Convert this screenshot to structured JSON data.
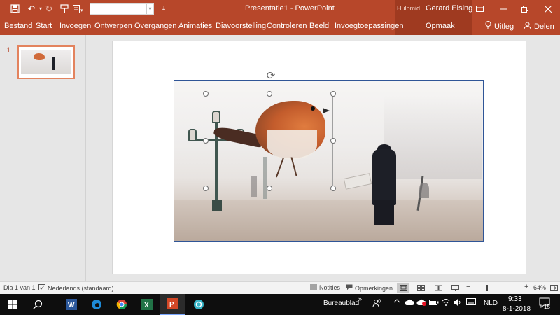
{
  "window": {
    "title": "Presentatie1  -  PowerPoint",
    "contextual_group": "Hulpmid...",
    "user": "Gerard Elsing",
    "controls": [
      "minimize",
      "maximize",
      "close"
    ]
  },
  "quick_access": {
    "icons": [
      "save-icon",
      "undo-icon",
      "redo-icon",
      "format-painter-icon",
      "customize-icon"
    ],
    "combo_value": ""
  },
  "ribbon": {
    "tabs": [
      "Bestand",
      "Start",
      "Invoegen",
      "Ontwerpen",
      "Overgangen",
      "Animaties",
      "Diavoorstelling",
      "Controleren",
      "Beeld",
      "Invoegtoepassingen"
    ],
    "contextual_tab": "Opmaak",
    "tell_me": "Uitleg",
    "share": "Delen"
  },
  "thumbnails": {
    "slides": [
      {
        "number": "1"
      }
    ]
  },
  "status": {
    "slide_info": "Dia 1 van 1",
    "language": "Nederlands (standaard)",
    "notes": "Notities",
    "comments": "Opmerkingen",
    "zoom": "64%"
  },
  "taskbar": {
    "apps": [
      "word-icon",
      "edge-icon",
      "chrome-icon",
      "excel-icon",
      "powerpoint-icon",
      "browser-icon"
    ],
    "active_app": "powerpoint-icon",
    "desktop_label": "Bureaublad",
    "language": "NLD",
    "time": "9:33",
    "date": "8-1-2018",
    "notifications": "15"
  }
}
